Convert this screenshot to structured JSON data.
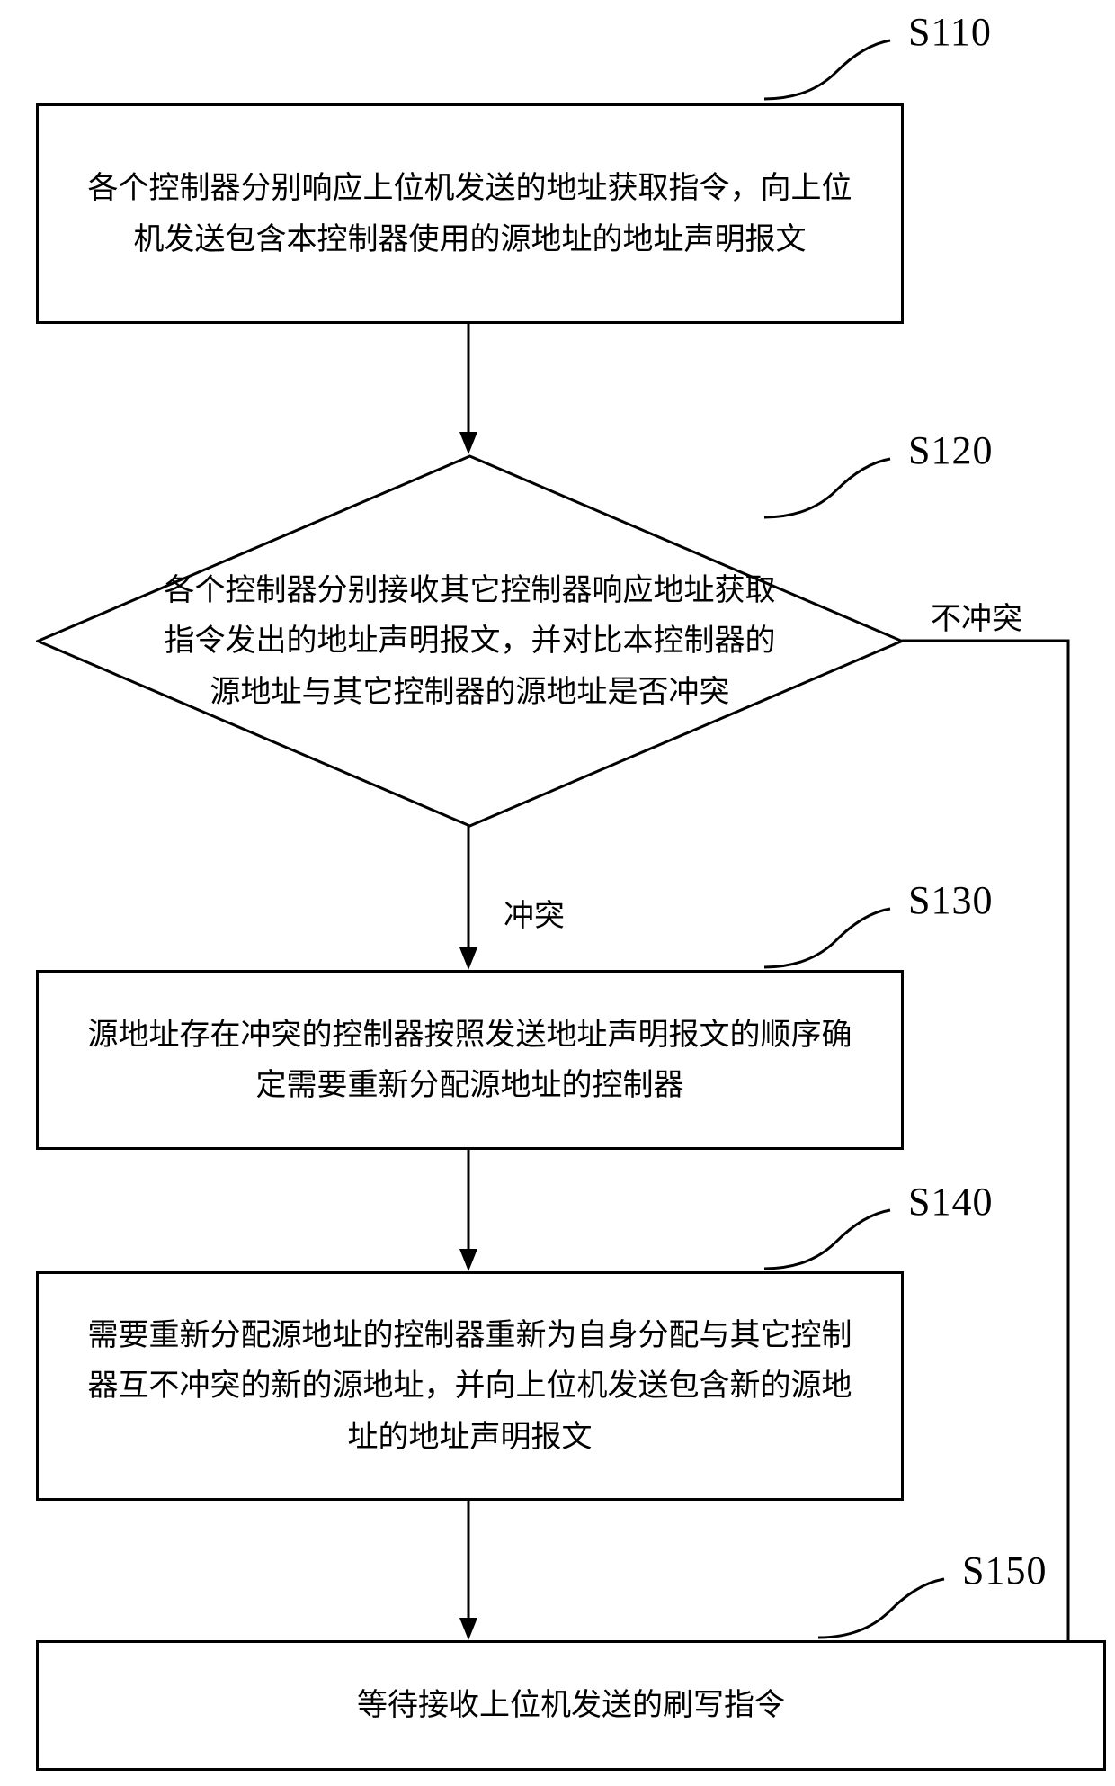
{
  "chart_data": {
    "type": "flowchart",
    "nodes": [
      {
        "id": "S110",
        "shape": "rect",
        "text": "各个控制器分别响应上位机发送的地址获取指令，向上位机发送包含本控制器使用的源地址的地址声明报文"
      },
      {
        "id": "S120",
        "shape": "diamond",
        "text": "各个控制器分别接收其它控制器响应地址获取指令发出的地址声明报文，并对比本控制器的源地址与其它控制器的源地址是否冲突"
      },
      {
        "id": "S130",
        "shape": "rect",
        "text": "源地址存在冲突的控制器按照发送地址声明报文的顺序确定需要重新分配源地址的控制器"
      },
      {
        "id": "S140",
        "shape": "rect",
        "text": "需要重新分配源地址的控制器重新为自身分配与其它控制器互不冲突的新的源地址，并向上位机发送包含新的源地址的地址声明报文"
      },
      {
        "id": "S150",
        "shape": "rect",
        "text": "等待接收上位机发送的刷写指令"
      }
    ],
    "edges": [
      {
        "from": "S110",
        "to": "S120",
        "label": ""
      },
      {
        "from": "S120",
        "to": "S130",
        "label": "冲突"
      },
      {
        "from": "S120",
        "to": "S150",
        "label": "不冲突"
      },
      {
        "from": "S130",
        "to": "S140",
        "label": ""
      },
      {
        "from": "S140",
        "to": "S150",
        "label": ""
      }
    ]
  },
  "labels": {
    "s110": "S110",
    "s120": "S120",
    "s130": "S130",
    "s140": "S140",
    "s150": "S150",
    "conflict": "冲突",
    "noconflict": "不冲突"
  }
}
